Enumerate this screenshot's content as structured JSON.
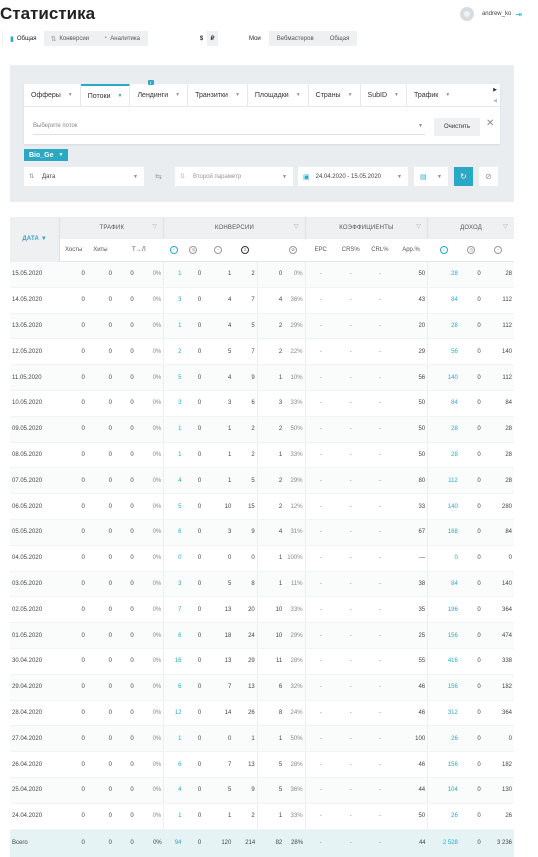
{
  "page": {
    "title": "Статистика"
  },
  "user": {
    "name": "andrew_ko"
  },
  "view_tabs": [
    {
      "label": "Общая",
      "icon": "bar-chart-icon"
    },
    {
      "label": "Конверсии",
      "icon": "sort-icon"
    },
    {
      "label": "Аналитика",
      "icon": "chart-icon"
    }
  ],
  "currency": [
    "$",
    "₽"
  ],
  "scope_tabs": [
    "Мои",
    "Вебмастеров",
    "Общая"
  ],
  "filter_tabs": [
    "Офферы",
    "Потоки",
    "Лендинги",
    "Транзитки",
    "Площадки",
    "Страны",
    "SubID",
    "Трафик"
  ],
  "filter_badge": "1",
  "filter_input": {
    "placeholder": "Выберите поток"
  },
  "clear_button": "Очистить",
  "selected_tag": "Bio_Ge",
  "controls": {
    "group_by": "Дата",
    "second_param": "Второй параметр",
    "date_range": "24.04.2020 - 15.05.2020"
  },
  "table": {
    "groups": {
      "date": "ДАТА",
      "traffic": "ТРАФИК",
      "conversions": "КОНВЕРСИИ",
      "coefficients": "КОЭФФИЦИЕНТЫ",
      "income": "ДОХОД"
    },
    "subheaders": {
      "hosts": "Хосты",
      "hits": "Хиты",
      "tl": "Т→Л",
      "epc": "EPC",
      "crs": "CRS%",
      "crl": "CRL%",
      "app": "App.%"
    },
    "rows": [
      {
        "date": "15.05.2020",
        "hosts": "0",
        "hits": "0",
        "tl": "0",
        "tlp": "0%",
        "c1": "1",
        "c2": "0",
        "c3": "1",
        "c4": "2",
        "c5": "0",
        "c5p": "0%",
        "epc": "-",
        "crs": "-",
        "crl": "-",
        "app": "50",
        "i1": "28",
        "i2": "0",
        "i3": "28"
      },
      {
        "date": "14.05.2020",
        "hosts": "0",
        "hits": "0",
        "tl": "0",
        "tlp": "0%",
        "c1": "3",
        "c2": "0",
        "c3": "4",
        "c4": "7",
        "c5": "4",
        "c5p": "36%",
        "epc": "-",
        "crs": "-",
        "crl": "-",
        "app": "43",
        "i1": "84",
        "i2": "0",
        "i3": "112"
      },
      {
        "date": "13.05.2020",
        "hosts": "0",
        "hits": "0",
        "tl": "0",
        "tlp": "0%",
        "c1": "1",
        "c2": "0",
        "c3": "4",
        "c4": "5",
        "c5": "2",
        "c5p": "29%",
        "epc": "-",
        "crs": "-",
        "crl": "-",
        "app": "20",
        "i1": "28",
        "i2": "0",
        "i3": "112"
      },
      {
        "date": "12.05.2020",
        "hosts": "0",
        "hits": "0",
        "tl": "0",
        "tlp": "0%",
        "c1": "2",
        "c2": "0",
        "c3": "5",
        "c4": "7",
        "c5": "2",
        "c5p": "22%",
        "epc": "-",
        "crs": "-",
        "crl": "-",
        "app": "29",
        "i1": "56",
        "i2": "0",
        "i3": "140"
      },
      {
        "date": "11.05.2020",
        "hosts": "0",
        "hits": "0",
        "tl": "0",
        "tlp": "0%",
        "c1": "5",
        "c2": "0",
        "c3": "4",
        "c4": "9",
        "c5": "1",
        "c5p": "10%",
        "epc": "-",
        "crs": "-",
        "crl": "-",
        "app": "56",
        "i1": "140",
        "i2": "0",
        "i3": "112"
      },
      {
        "date": "10.05.2020",
        "hosts": "0",
        "hits": "0",
        "tl": "0",
        "tlp": "0%",
        "c1": "3",
        "c2": "0",
        "c3": "3",
        "c4": "6",
        "c5": "3",
        "c5p": "33%",
        "epc": "-",
        "crs": "-",
        "crl": "-",
        "app": "50",
        "i1": "84",
        "i2": "0",
        "i3": "84"
      },
      {
        "date": "09.05.2020",
        "hosts": "0",
        "hits": "0",
        "tl": "0",
        "tlp": "0%",
        "c1": "1",
        "c2": "0",
        "c3": "1",
        "c4": "2",
        "c5": "2",
        "c5p": "50%",
        "epc": "-",
        "crs": "-",
        "crl": "-",
        "app": "50",
        "i1": "28",
        "i2": "0",
        "i3": "28"
      },
      {
        "date": "08.05.2020",
        "hosts": "0",
        "hits": "0",
        "tl": "0",
        "tlp": "0%",
        "c1": "1",
        "c2": "0",
        "c3": "1",
        "c4": "2",
        "c5": "1",
        "c5p": "33%",
        "epc": "-",
        "crs": "-",
        "crl": "-",
        "app": "50",
        "i1": "28",
        "i2": "0",
        "i3": "28"
      },
      {
        "date": "07.05.2020",
        "hosts": "0",
        "hits": "0",
        "tl": "0",
        "tlp": "0%",
        "c1": "4",
        "c2": "0",
        "c3": "1",
        "c4": "5",
        "c5": "2",
        "c5p": "29%",
        "epc": "-",
        "crs": "-",
        "crl": "-",
        "app": "80",
        "i1": "112",
        "i2": "0",
        "i3": "28"
      },
      {
        "date": "06.05.2020",
        "hosts": "0",
        "hits": "0",
        "tl": "0",
        "tlp": "0%",
        "c1": "5",
        "c2": "0",
        "c3": "10",
        "c4": "15",
        "c5": "2",
        "c5p": "12%",
        "epc": "-",
        "crs": "-",
        "crl": "-",
        "app": "33",
        "i1": "140",
        "i2": "0",
        "i3": "280"
      },
      {
        "date": "05.05.2020",
        "hosts": "0",
        "hits": "0",
        "tl": "0",
        "tlp": "0%",
        "c1": "6",
        "c2": "0",
        "c3": "3",
        "c4": "9",
        "c5": "4",
        "c5p": "31%",
        "epc": "-",
        "crs": "-",
        "crl": "-",
        "app": "67",
        "i1": "168",
        "i2": "0",
        "i3": "84"
      },
      {
        "date": "04.05.2020",
        "hosts": "0",
        "hits": "0",
        "tl": "0",
        "tlp": "0%",
        "c1": "0",
        "c2": "0",
        "c3": "0",
        "c4": "0",
        "c5": "1",
        "c5p": "100%",
        "epc": "-",
        "crs": "-",
        "crl": "-",
        "app": "—",
        "i1": "0",
        "i2": "0",
        "i3": "0"
      },
      {
        "date": "03.05.2020",
        "hosts": "0",
        "hits": "0",
        "tl": "0",
        "tlp": "0%",
        "c1": "3",
        "c2": "0",
        "c3": "5",
        "c4": "8",
        "c5": "1",
        "c5p": "11%",
        "epc": "-",
        "crs": "-",
        "crl": "-",
        "app": "38",
        "i1": "84",
        "i2": "0",
        "i3": "140"
      },
      {
        "date": "02.05.2020",
        "hosts": "0",
        "hits": "0",
        "tl": "0",
        "tlp": "0%",
        "c1": "7",
        "c2": "0",
        "c3": "13",
        "c4": "20",
        "c5": "10",
        "c5p": "33%",
        "epc": "-",
        "crs": "-",
        "crl": "-",
        "app": "35",
        "i1": "196",
        "i2": "0",
        "i3": "364"
      },
      {
        "date": "01.05.2020",
        "hosts": "0",
        "hits": "0",
        "tl": "0",
        "tlp": "0%",
        "c1": "6",
        "c2": "0",
        "c3": "18",
        "c4": "24",
        "c5": "10",
        "c5p": "29%",
        "epc": "-",
        "crs": "-",
        "crl": "-",
        "app": "25",
        "i1": "156",
        "i2": "0",
        "i3": "474"
      },
      {
        "date": "30.04.2020",
        "hosts": "0",
        "hits": "0",
        "tl": "0",
        "tlp": "0%",
        "c1": "16",
        "c2": "0",
        "c3": "13",
        "c4": "29",
        "c5": "11",
        "c5p": "28%",
        "epc": "-",
        "crs": "-",
        "crl": "-",
        "app": "55",
        "i1": "416",
        "i2": "0",
        "i3": "338"
      },
      {
        "date": "29.04.2020",
        "hosts": "0",
        "hits": "0",
        "tl": "0",
        "tlp": "0%",
        "c1": "6",
        "c2": "0",
        "c3": "7",
        "c4": "13",
        "c5": "6",
        "c5p": "32%",
        "epc": "-",
        "crs": "-",
        "crl": "-",
        "app": "46",
        "i1": "156",
        "i2": "0",
        "i3": "182"
      },
      {
        "date": "28.04.2020",
        "hosts": "0",
        "hits": "0",
        "tl": "0",
        "tlp": "0%",
        "c1": "12",
        "c2": "0",
        "c3": "14",
        "c4": "26",
        "c5": "8",
        "c5p": "24%",
        "epc": "-",
        "crs": "-",
        "crl": "-",
        "app": "46",
        "i1": "312",
        "i2": "0",
        "i3": "364"
      },
      {
        "date": "27.04.2020",
        "hosts": "0",
        "hits": "0",
        "tl": "0",
        "tlp": "0%",
        "c1": "1",
        "c2": "0",
        "c3": "0",
        "c4": "1",
        "c5": "1",
        "c5p": "50%",
        "epc": "-",
        "crs": "-",
        "crl": "-",
        "app": "100",
        "i1": "26",
        "i2": "0",
        "i3": "0"
      },
      {
        "date": "26.04.2020",
        "hosts": "0",
        "hits": "0",
        "tl": "0",
        "tlp": "0%",
        "c1": "6",
        "c2": "0",
        "c3": "7",
        "c4": "13",
        "c5": "5",
        "c5p": "28%",
        "epc": "-",
        "crs": "-",
        "crl": "-",
        "app": "46",
        "i1": "156",
        "i2": "0",
        "i3": "182"
      },
      {
        "date": "25.04.2020",
        "hosts": "0",
        "hits": "0",
        "tl": "0",
        "tlp": "0%",
        "c1": "4",
        "c2": "0",
        "c3": "5",
        "c4": "9",
        "c5": "5",
        "c5p": "36%",
        "epc": "-",
        "crs": "-",
        "crl": "-",
        "app": "44",
        "i1": "104",
        "i2": "0",
        "i3": "130"
      },
      {
        "date": "24.04.2020",
        "hosts": "0",
        "hits": "0",
        "tl": "0",
        "tlp": "0%",
        "c1": "1",
        "c2": "0",
        "c3": "1",
        "c4": "2",
        "c5": "1",
        "c5p": "33%",
        "epc": "-",
        "crs": "-",
        "crl": "-",
        "app": "50",
        "i1": "26",
        "i2": "0",
        "i3": "26"
      }
    ],
    "total": {
      "date": "Всего",
      "hosts": "0",
      "hits": "0",
      "tl": "0",
      "tlp": "0%",
      "c1": "94",
      "c2": "0",
      "c3": "120",
      "c4": "214",
      "c5": "82",
      "c5p": "28%",
      "epc": "-",
      "crs": "-",
      "crl": "-",
      "app": "44",
      "i1": "2 528",
      "i2": "0",
      "i3": "3 236"
    }
  },
  "colors": {
    "accent": "#2aa8c4",
    "panel": "#e9edf0"
  }
}
